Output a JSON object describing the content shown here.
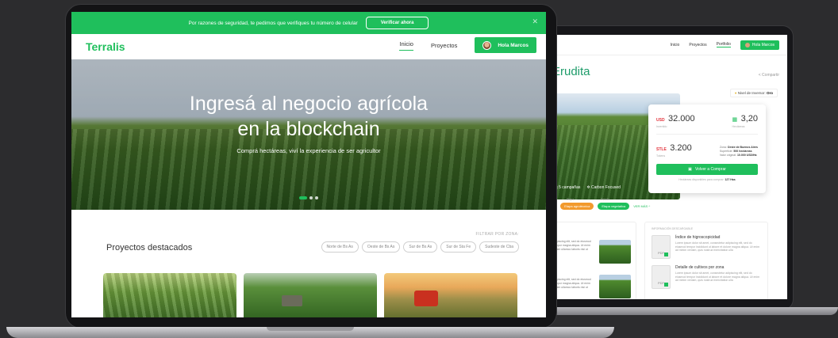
{
  "front": {
    "banner": {
      "message": "Por razones de seguridad, te pedimos que verifiques tu número de celular",
      "verify_label": "Verificar ahora"
    },
    "nav": {
      "logo": "Terralis",
      "links": [
        "Inicio",
        "Proyectos"
      ],
      "active_link": "Inicio",
      "user_label": "Hola Marcos"
    },
    "hero": {
      "title_line1": "Ingresá al negocio agrícola",
      "title_line2": "en la blockchain",
      "subtitle": "Comprá hectáreas, viví la experiencia de ser agricultor",
      "slides": 3,
      "active_slide": 1
    },
    "featured": {
      "title": "Proyectos destacados",
      "filter_label": "FILTRAR POR ZONA:",
      "zones": [
        "Norte de Bs As",
        "Oeste de Bs As",
        "Sur de Bs As",
        "Sur de Sta Fe",
        "Sudeste de Cba"
      ]
    }
  },
  "back": {
    "nav": {
      "links": [
        "Inicio",
        "Proyectos",
        "Portfolio"
      ],
      "active_link": "Portfolio",
      "user_label": "Hola Marcos"
    },
    "project_title": "Erudita",
    "share_label": "Compartir",
    "investor_level": {
      "label": "Nivel de Inversor:",
      "value": "Oro"
    },
    "tags": [
      "5 campañas",
      "Carbon Focused"
    ],
    "card": {
      "usd_currency": "USD",
      "usd_value": "32.000",
      "usd_caption": "Invertido",
      "hectares_value": "3,20",
      "hectares_caption": "Hectáreas",
      "stle_currency": "STLE",
      "stle_value": "3.200",
      "stle_caption": "Tokens",
      "spec_zone_label": "Zona:",
      "spec_zone": "Oeste de Buenos Aires",
      "spec_area_label": "Superficie:",
      "spec_area": "500 hectáreas",
      "spec_value_label": "Valor original:",
      "spec_value": "10.000 USD/Ha",
      "button_label": "Volver a Comprar",
      "footer_label": "Hectáreas disponibles para comprar:",
      "footer_value": "127 Has"
    },
    "chips": [
      "Etapa agrotécnica",
      "Etapa vegetativa"
    ],
    "chip_labels": [
      "Etapa",
      "Estado"
    ],
    "see_more": "VER MÁS",
    "left_texts": [
      "adipiscing elit, sed do eiusmod tempor magna aliqua. Ut enim minim ullamco laboris nisi ut",
      "adipiscing elit, sed do eiusmod tempor magna aliqua. Ut enim minim ullamco laboris nisi ut"
    ],
    "info_header": "INFORMACIÓN DESCARGABLE",
    "docs": [
      {
        "title": "Índice de higroscopicidad",
        "text": "Lorem ipsum dolor sit amet, consectetur adipiscing elit, sed do eiusmod tempor incididunt ut labore et dolore magna aliqua. Ut enim ad minim veniam, quis nostrud exercitation ulla"
      },
      {
        "title": "Detalle de cultivos por zona",
        "text": "Lorem ipsum dolor sit amet, consectetur adipiscing elit, sed do eiusmod tempor incididunt ut labore et dolore magna aliqua. Ut enim ad minim veniam, quis nostrud exercitation ulla"
      }
    ],
    "doc_icon_label": "PDF"
  },
  "colors": {
    "brand_green": "#1fbf5c",
    "title_teal": "#1e9c6a",
    "usd_red": "#e3323b",
    "chip_orange": "#f29a2e"
  }
}
